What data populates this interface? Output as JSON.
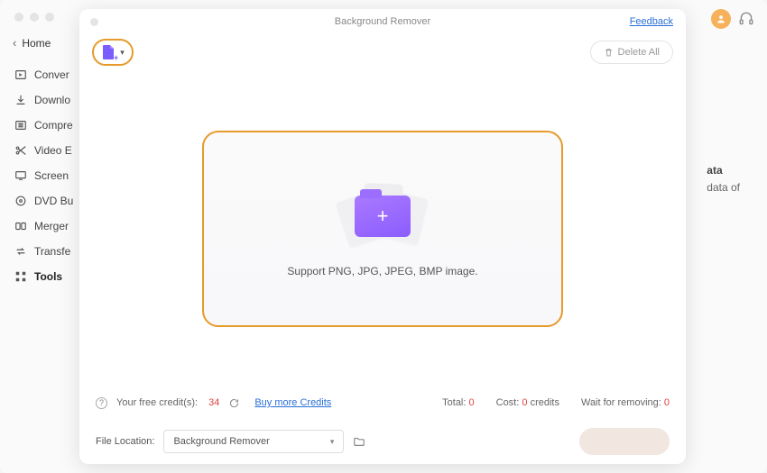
{
  "sidebar": {
    "home": "Home",
    "items": [
      {
        "label": "Conver"
      },
      {
        "label": "Downlo"
      },
      {
        "label": "Compre"
      },
      {
        "label": "Video E"
      },
      {
        "label": "Screen"
      },
      {
        "label": "DVD Bu"
      },
      {
        "label": "Merger"
      },
      {
        "label": "Transfe"
      },
      {
        "label": "Tools"
      }
    ]
  },
  "modal": {
    "title": "Background Remover",
    "feedback": "Feedback",
    "delete_all": "Delete All",
    "dropzone_text": "Support PNG, JPG, JPEG, BMP image."
  },
  "credits": {
    "label": "Your free credit(s):",
    "value": "34",
    "buy": "Buy more Credits",
    "total_label": "Total:",
    "total_value": "0",
    "cost_label": "Cost:",
    "cost_value": "0",
    "cost_unit": "credits",
    "wait_label": "Wait for removing:",
    "wait_value": "0"
  },
  "bottom": {
    "file_location_label": "File Location:",
    "location_value": "Background Remover"
  },
  "bg_panel": {
    "title": "ata",
    "line": "data of"
  }
}
